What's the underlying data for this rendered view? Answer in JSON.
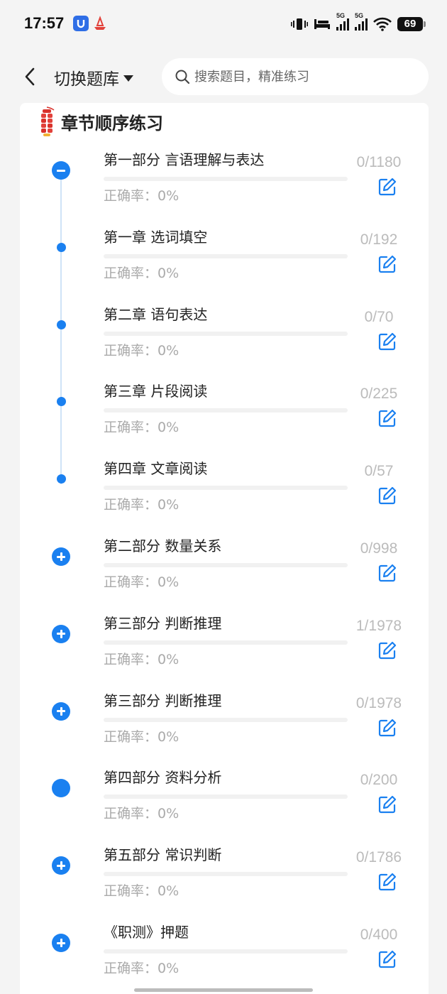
{
  "status": {
    "time": "17:57",
    "signal1_label": "5G",
    "signal2_label": "5G",
    "battery": "69"
  },
  "topbar": {
    "title": "切换题库",
    "search_placeholder": "搜索题目，精准练习"
  },
  "section": {
    "title": "章节顺序练习"
  },
  "accuracy_label": "正确率：",
  "items": [
    {
      "title": "第一部分 言语理解与表达",
      "accuracy": "正确率：0%",
      "count": "0/1180",
      "node": "minus",
      "progress": 0
    },
    {
      "title": "第一章 选词填空",
      "accuracy": "正确率：0%",
      "count": "0/192",
      "node": "dot",
      "progress": 0
    },
    {
      "title": "第二章 语句表达",
      "accuracy": "正确率：0%",
      "count": "0/70",
      "node": "dot",
      "progress": 0
    },
    {
      "title": "第三章 片段阅读",
      "accuracy": "正确率：0%",
      "count": "0/225",
      "node": "dot",
      "progress": 0
    },
    {
      "title": "第四章 文章阅读",
      "accuracy": "正确率：0%",
      "count": "0/57",
      "node": "dot",
      "progress": 0
    },
    {
      "title": "第二部分 数量关系",
      "accuracy": "正确率：0%",
      "count": "0/998",
      "node": "plus",
      "progress": 0
    },
    {
      "title": "第三部分 判断推理",
      "accuracy": "正确率：0%",
      "count": "1/1978",
      "node": "plus",
      "progress": 0
    },
    {
      "title": "第三部分 判断推理",
      "accuracy": "正确率：0%",
      "count": "0/1978",
      "node": "plus",
      "progress": 0
    },
    {
      "title": "第四部分 资料分析",
      "accuracy": "正确率：0%",
      "count": "0/200",
      "node": "filled",
      "progress": 0
    },
    {
      "title": "第五部分 常识判断",
      "accuracy": "正确率：0%",
      "count": "0/1786",
      "node": "plus",
      "progress": 0
    },
    {
      "title": "《职测》押题",
      "accuracy": "正确率：0%",
      "count": "0/400",
      "node": "plus",
      "progress": 0
    }
  ],
  "colors": {
    "accent": "#1a80f0",
    "muted": "#aaaaaa",
    "track": "#f1f1f1"
  }
}
